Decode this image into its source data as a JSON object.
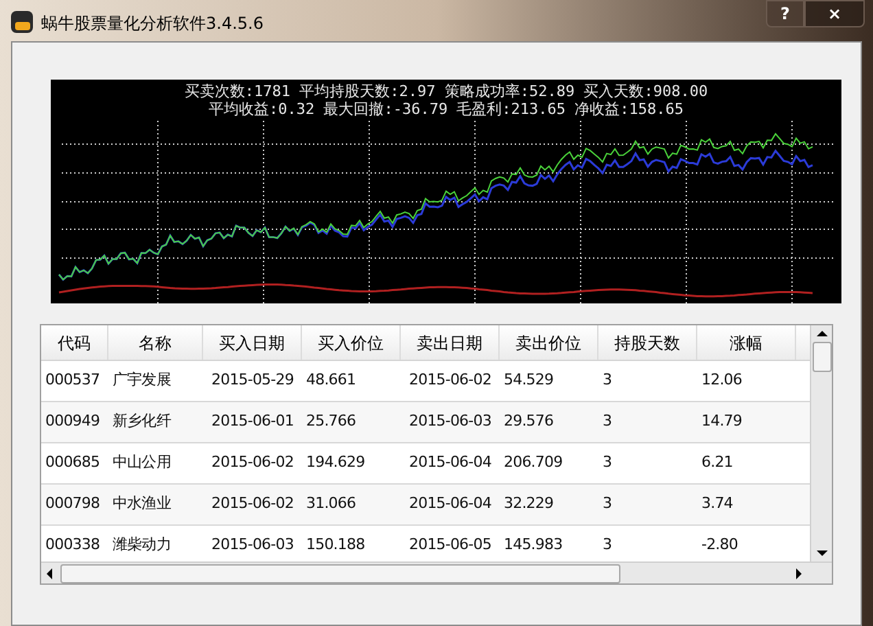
{
  "window": {
    "title": "蜗牛股票量化分析软件3.4.5.6",
    "buttons": [
      "?",
      "×"
    ]
  },
  "summary": {
    "line_1": "买卖次数:1781 平均持股天数:2.97 策略成功率:52.89 买入天数:908.00",
    "line_2": "平均收益:0.32 最大回撤:-36.79 毛盈利:213.65 净收益:158.65"
  },
  "table": {
    "columns": [
      "代码",
      "名称",
      "买入日期",
      "买入价位",
      "卖出日期",
      "卖出价位",
      "持股天数",
      "涨幅"
    ],
    "rows": [
      [
        "000537",
        "广宇发展",
        "2015-05-29",
        "48.661",
        "2015-06-02",
        "54.529",
        "3",
        "12.06"
      ],
      [
        "000949",
        "新乡化纤",
        "2015-06-01",
        "25.766",
        "2015-06-03",
        "29.576",
        "3",
        "14.79"
      ],
      [
        "000685",
        "中山公用",
        "2015-06-02",
        "194.629",
        "2015-06-04",
        "206.709",
        "3",
        "6.21"
      ],
      [
        "000798",
        "中水渔业",
        "2015-06-02",
        "31.066",
        "2015-06-04",
        "32.229",
        "3",
        "3.74"
      ],
      [
        "000338",
        "潍柴动力",
        "2015-06-03",
        "150.188",
        "2015-06-05",
        "145.983",
        "3",
        "-2.80"
      ]
    ]
  }
}
